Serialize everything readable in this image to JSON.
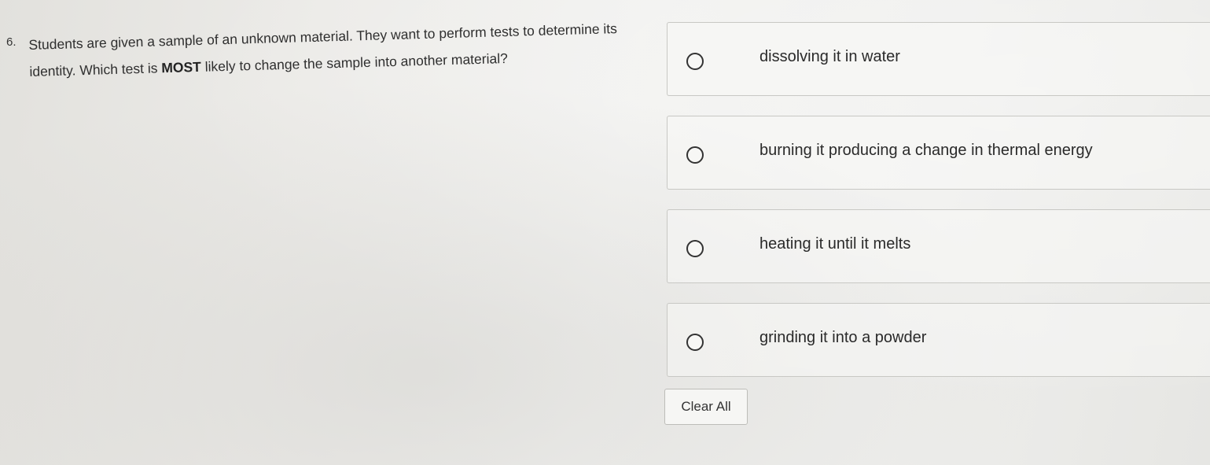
{
  "question": {
    "number": "6.",
    "text_before_emphasis": "Students are given a sample of an unknown material. They want to perform tests to determine its identity. Which test is ",
    "emphasis": "MOST",
    "text_after_emphasis": " likely to change the sample into another material?"
  },
  "options": [
    {
      "label": "dissolving it in water"
    },
    {
      "label": "burning it producing a change in thermal energy"
    },
    {
      "label": "heating it until it melts"
    },
    {
      "label": "grinding it into a powder"
    }
  ],
  "actions": {
    "clear_all_label": "Clear All"
  }
}
